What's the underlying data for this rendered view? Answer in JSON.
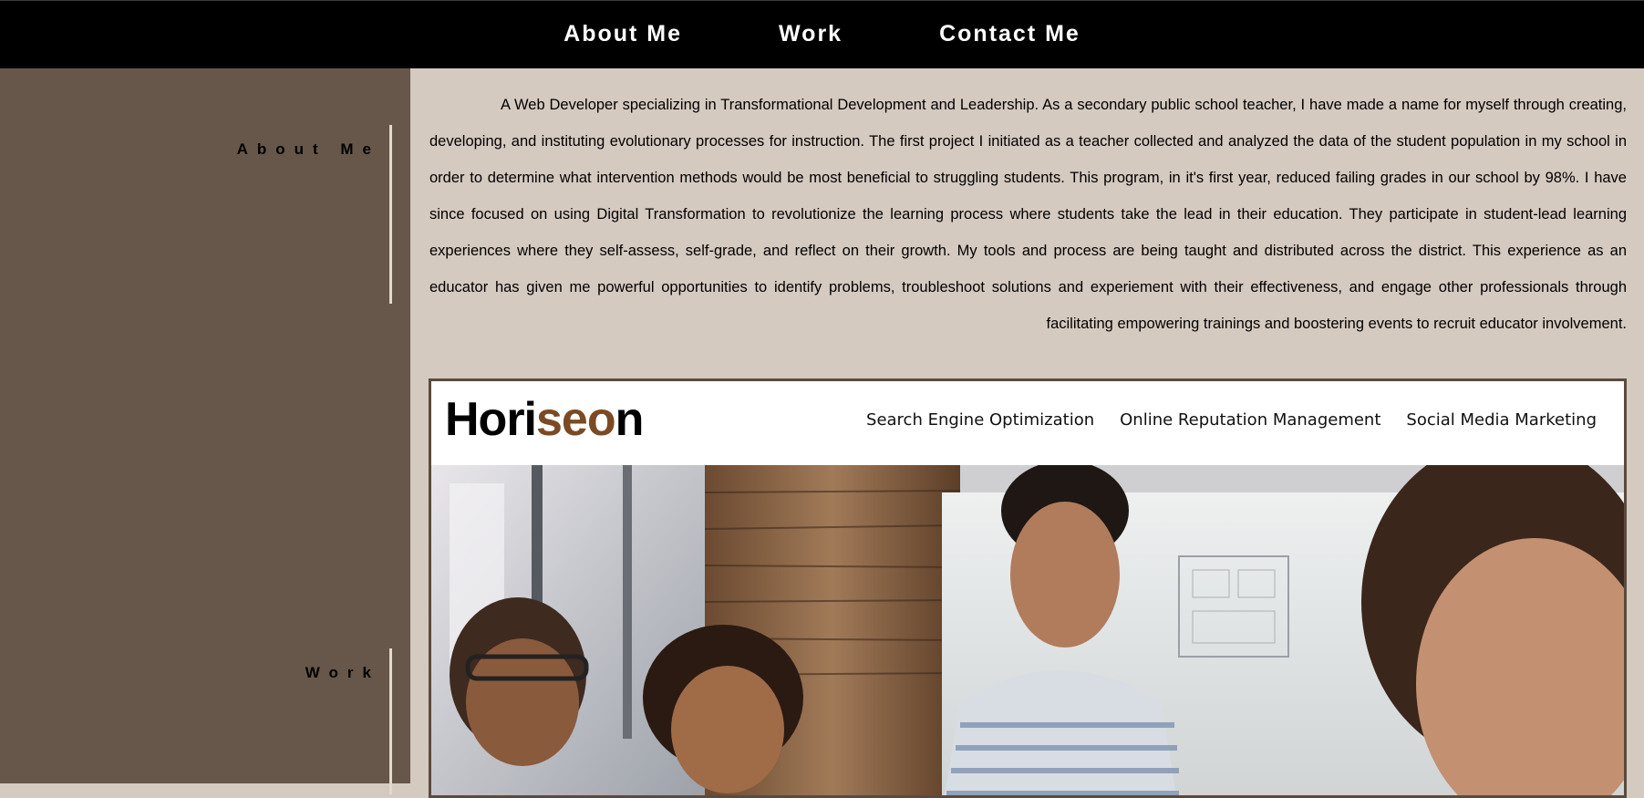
{
  "nav": {
    "items": [
      {
        "label": "About Me"
      },
      {
        "label": "Work"
      },
      {
        "label": "Contact Me"
      }
    ]
  },
  "sidebar": {
    "about_label": "About Me",
    "work_label": "Work"
  },
  "about": {
    "text": "A Web Developer specializing in Transformational Development and Leadership. As a secondary public school teacher, I have made a name for myself through creating, developing, and instituting evolutionary processes for instruction. The first project I initiated as a teacher collected and analyzed the data of the student population in my school in order to determine what intervention methods would be most beneficial to struggling students. This program, in it's first year, reduced failing grades in our school by 98%. I have since focused on using Digital Transformation to revolutionize the learning process where students take the lead in their education. They participate in student-lead learning experiences where they self-assess, self-grade, and reflect on their growth. My tools and process are being taught and distributed across the district. This experience as an educator has given me powerful opportunities to identify problems, troubleshoot solutions and experiement with their effectiveness, and engage other professionals through facilitating empowering trainings and boostering events to recruit educator involvement."
  },
  "project": {
    "logo_part1": "Hori",
    "logo_part2": "seo",
    "logo_part3": "n",
    "links": [
      {
        "label": "Search Engine Optimization"
      },
      {
        "label": "Online Reputation Management"
      },
      {
        "label": "Social Media Marketing"
      }
    ]
  },
  "colors": {
    "nav_bg": "#000000",
    "sidebar_bg": "#66574a",
    "main_bg": "#d5cac0",
    "logo_accent": "#7b4a24",
    "project_border": "#5b4b3e"
  }
}
